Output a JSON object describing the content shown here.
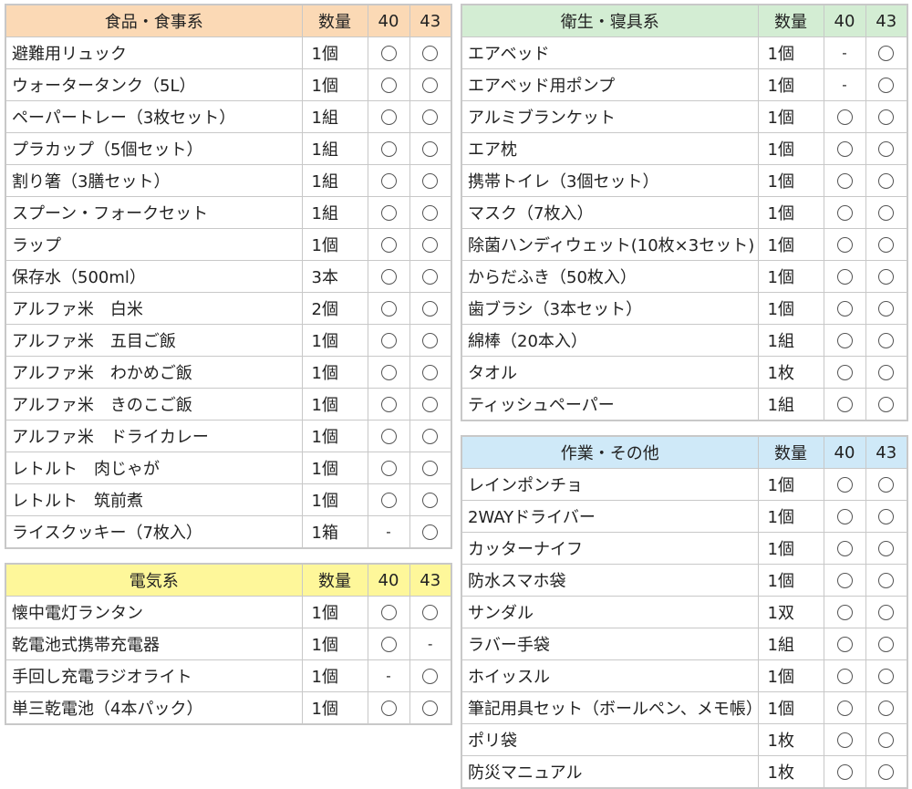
{
  "colors": {
    "food_header": "#fbd9b5",
    "electric_header": "#fef79a",
    "hygiene_header": "#d3edd3",
    "work_header": "#cfe9f8",
    "border": "#c8c8c8"
  },
  "icons": {
    "circle": "circle-mark-icon",
    "dash": "dash-mark"
  },
  "tables": [
    {
      "id": "food",
      "title": "食品・食事系",
      "qty_header": "数量",
      "col_a": "40",
      "col_b": "43",
      "rows": [
        {
          "name": "避難用リュック",
          "qty": "1個",
          "a": "circle",
          "b": "circle"
        },
        {
          "name": "ウォータータンク（5L）",
          "qty": "1個",
          "a": "circle",
          "b": "circle"
        },
        {
          "name": "ペーパートレー（3枚セット）",
          "qty": "1組",
          "a": "circle",
          "b": "circle"
        },
        {
          "name": "プラカップ（5個セット）",
          "qty": "1組",
          "a": "circle",
          "b": "circle"
        },
        {
          "name": "割り箸（3膳セット）",
          "qty": "1組",
          "a": "circle",
          "b": "circle"
        },
        {
          "name": "スプーン・フォークセット",
          "qty": "1組",
          "a": "circle",
          "b": "circle"
        },
        {
          "name": "ラップ",
          "qty": "1個",
          "a": "circle",
          "b": "circle"
        },
        {
          "name": "保存水（500ml）",
          "qty": "3本",
          "a": "circle",
          "b": "circle"
        },
        {
          "name": "アルファ米　白米",
          "qty": "2個",
          "a": "circle",
          "b": "circle"
        },
        {
          "name": "アルファ米　五目ご飯",
          "qty": "1個",
          "a": "circle",
          "b": "circle"
        },
        {
          "name": "アルファ米　わかめご飯",
          "qty": "1個",
          "a": "circle",
          "b": "circle"
        },
        {
          "name": "アルファ米　きのこご飯",
          "qty": "1個",
          "a": "circle",
          "b": "circle"
        },
        {
          "name": "アルファ米　ドライカレー",
          "qty": "1個",
          "a": "circle",
          "b": "circle"
        },
        {
          "name": "レトルト　肉じゃが",
          "qty": "1個",
          "a": "circle",
          "b": "circle"
        },
        {
          "name": "レトルト　筑前煮",
          "qty": "1個",
          "a": "circle",
          "b": "circle"
        },
        {
          "name": "ライスクッキー（7枚入）",
          "qty": "1箱",
          "a": "-",
          "b": "circle"
        }
      ]
    },
    {
      "id": "elec",
      "title": "電気系",
      "qty_header": "数量",
      "col_a": "40",
      "col_b": "43",
      "rows": [
        {
          "name": "懐中電灯ランタン",
          "qty": "1個",
          "a": "circle",
          "b": "circle"
        },
        {
          "name": "乾電池式携帯充電器",
          "qty": "1個",
          "a": "circle",
          "b": "-"
        },
        {
          "name": "手回し充電ラジオライト",
          "qty": "1個",
          "a": "-",
          "b": "circle"
        },
        {
          "name": "単三乾電池（4本パック）",
          "qty": "1個",
          "a": "circle",
          "b": "circle"
        }
      ]
    },
    {
      "id": "hyg",
      "title": "衛生・寝具系",
      "qty_header": "数量",
      "col_a": "40",
      "col_b": "43",
      "rows": [
        {
          "name": "エアベッド",
          "qty": "1個",
          "a": "-",
          "b": "circle"
        },
        {
          "name": "エアベッド用ポンプ",
          "qty": "1個",
          "a": "-",
          "b": "circle"
        },
        {
          "name": "アルミブランケット",
          "qty": "1個",
          "a": "circle",
          "b": "circle"
        },
        {
          "name": "エア枕",
          "qty": "1個",
          "a": "circle",
          "b": "circle"
        },
        {
          "name": "携帯トイレ（3個セット）",
          "qty": "1個",
          "a": "circle",
          "b": "circle"
        },
        {
          "name": "マスク（7枚入）",
          "qty": "1個",
          "a": "circle",
          "b": "circle"
        },
        {
          "name": "除菌ハンディウェット(10枚×3セット)",
          "qty": "1個",
          "a": "circle",
          "b": "circle"
        },
        {
          "name": "からだふき（50枚入）",
          "qty": "1個",
          "a": "circle",
          "b": "circle"
        },
        {
          "name": "歯ブラシ（3本セット）",
          "qty": "1個",
          "a": "circle",
          "b": "circle"
        },
        {
          "name": "綿棒（20本入）",
          "qty": "1組",
          "a": "circle",
          "b": "circle"
        },
        {
          "name": "タオル",
          "qty": "1枚",
          "a": "circle",
          "b": "circle"
        },
        {
          "name": "ティッシュペーパー",
          "qty": "1組",
          "a": "circle",
          "b": "circle"
        }
      ]
    },
    {
      "id": "work",
      "title": "作業・その他",
      "qty_header": "数量",
      "col_a": "40",
      "col_b": "43",
      "rows": [
        {
          "name": "レインポンチョ",
          "qty": "1個",
          "a": "circle",
          "b": "circle"
        },
        {
          "name": "2WAYドライバー",
          "qty": "1個",
          "a": "circle",
          "b": "circle"
        },
        {
          "name": "カッターナイフ",
          "qty": "1個",
          "a": "circle",
          "b": "circle"
        },
        {
          "name": "防水スマホ袋",
          "qty": "1個",
          "a": "circle",
          "b": "circle"
        },
        {
          "name": "サンダル",
          "qty": "1双",
          "a": "circle",
          "b": "circle"
        },
        {
          "name": "ラバー手袋",
          "qty": "1組",
          "a": "circle",
          "b": "circle"
        },
        {
          "name": "ホイッスル",
          "qty": "1個",
          "a": "circle",
          "b": "circle"
        },
        {
          "name": "筆記用具セット（ボールペン、メモ帳）",
          "qty": "1個",
          "a": "circle",
          "b": "circle"
        },
        {
          "name": "ポリ袋",
          "qty": "1枚",
          "a": "circle",
          "b": "circle"
        },
        {
          "name": "防災マニュアル",
          "qty": "1枚",
          "a": "circle",
          "b": "circle"
        }
      ]
    }
  ]
}
